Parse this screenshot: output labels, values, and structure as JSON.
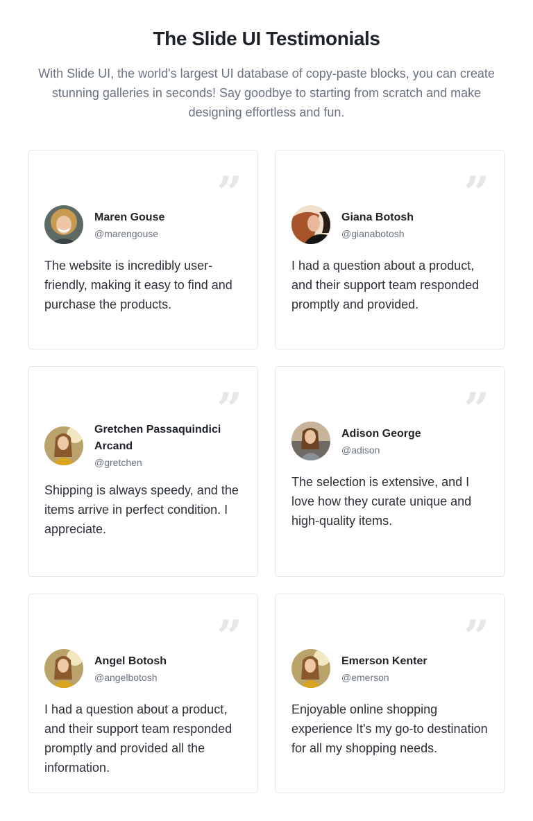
{
  "header": {
    "title": "The Slide UI Testimonials",
    "subtitle": "With Slide UI, the world's largest UI database of copy-paste blocks, you can create stunning galleries in seconds! Say goodbye to starting from scratch and make designing effortless and fun."
  },
  "quote_icon": "quote-icon",
  "testimonials": [
    {
      "name": "Maren Gouse",
      "handle": "@marengouse",
      "text": "The website is incredibly user-friendly, making it easy to find and purchase the products."
    },
    {
      "name": "Giana Botosh",
      "handle": "@gianabotosh",
      "text": "I had a question about a product, and their support team responded promptly and provided."
    },
    {
      "name": "Gretchen Passaquindici Arcand",
      "handle": "@gretchen",
      "text": "Shipping is always speedy, and the items arrive in perfect condition. I appreciate."
    },
    {
      "name": "Adison George",
      "handle": "@adison",
      "text": "The selection is extensive, and I love how they curate unique and high-quality items."
    },
    {
      "name": "Angel Botosh",
      "handle": "@angelbotosh",
      "text": "I had a question about a product, and their support team responded promptly and provided all the information."
    },
    {
      "name": "Emerson Kenter",
      "handle": "@emerson",
      "text": "Enjoyable online shopping experience It's my go-to destination for all my shopping needs."
    }
  ]
}
